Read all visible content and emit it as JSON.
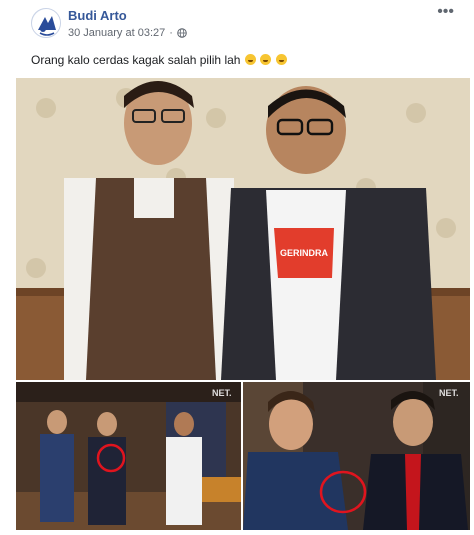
{
  "post": {
    "author": "Budi Arto",
    "timestamp": "30 January at 03:27",
    "privacy_icon": "globe-icon",
    "more_label": "•••",
    "caption_text": "Orang kalo cerdas kagak salah pilih lah",
    "caption_emoji_count": 3,
    "caption_emoji": "grinning-sweat-face"
  },
  "images": {
    "left_watermark": "NET.",
    "right_watermark": "NET.",
    "shirt_text": "GERINDRA"
  },
  "colors": {
    "author_link": "#365899",
    "highlight_circle": "#e0141e"
  }
}
